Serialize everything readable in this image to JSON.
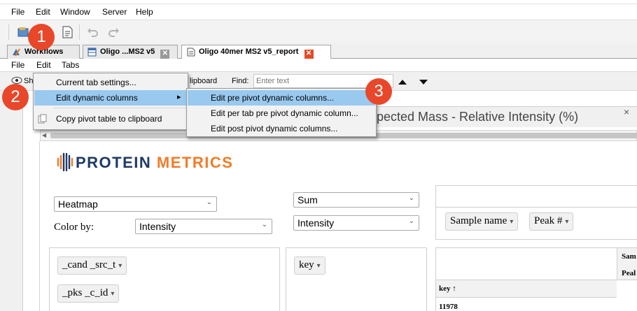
{
  "menubar": {
    "items": [
      "File",
      "Edit",
      "Window",
      "Server",
      "Help"
    ]
  },
  "tabs": [
    {
      "label": "Workflows",
      "close": ""
    },
    {
      "label": "Oligo ...MS2 v5",
      "close": "✕"
    },
    {
      "label": "Oligo 40mer MS2 v5_report",
      "close": "✕"
    }
  ],
  "submenubar": {
    "items": [
      "File",
      "Edit",
      "Tabs"
    ]
  },
  "subtoolbar": {
    "clipboard_fragment": "lipboard",
    "find_label": "Find:",
    "find_placeholder": "Enter text",
    "show_fragment": "Sh"
  },
  "edit_menu": {
    "items": [
      "Current tab settings...",
      "Edit dynamic columns",
      "Copy pivot table to clipboard"
    ],
    "arrow": "▸"
  },
  "dynamic_submenu": {
    "items": [
      "Edit pre pivot dynamic columns...",
      "Edit per tab pre pivot dynamic column...",
      "Edit post pivot dynamic columns..."
    ]
  },
  "badges": [
    "1",
    "2",
    "3"
  ],
  "content_tab": {
    "title": "pected Mass - Relative Intensity (%)",
    "close": "×"
  },
  "logo": {
    "part1": "PROTEIN",
    "part2": "METRICS",
    "color1": "#1f3a66",
    "color2": "#f07c28"
  },
  "controls": {
    "chart_type": "Heatmap",
    "color_by_label": "Color by:",
    "color_by_value": "Intensity",
    "aggregator": "Sum",
    "value_field": "Intensity",
    "caret": "⌄"
  },
  "column_pills": [
    "Sample name",
    "Peak #"
  ],
  "row_pills": [
    "_cand _src_t",
    "_pks _c_id"
  ],
  "key_pill": "key",
  "table": {
    "header_top": "Sam",
    "header_second": "Peal",
    "key_header": "key ↑",
    "first_key": "11978"
  },
  "colors": {
    "accent_red": "#e8472a",
    "highlight": "#99c9ef",
    "close_red": "#e24b26",
    "close_gray": "#9a9a9a"
  }
}
